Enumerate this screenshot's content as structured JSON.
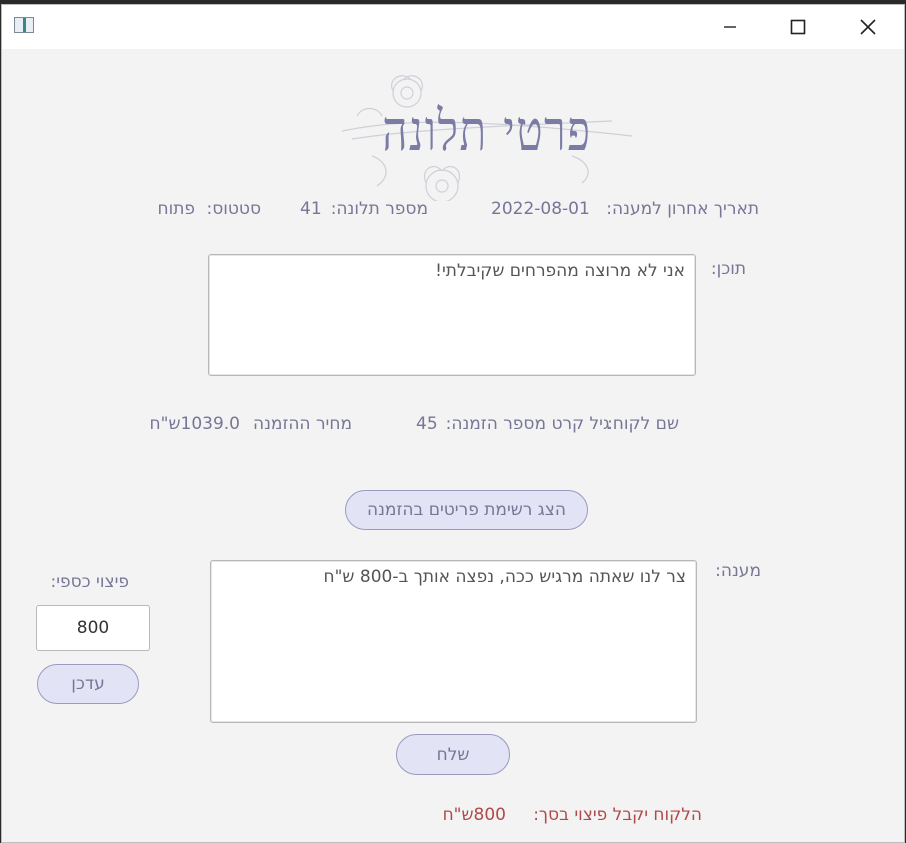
{
  "window": {
    "controls": {
      "minimize_icon": "minimize-icon",
      "maximize_icon": "maximize-icon",
      "close_icon": "close-icon"
    }
  },
  "header": {
    "title": "פרטי תלונה"
  },
  "complaint": {
    "status_label": "סטטוס:",
    "status_value": "פתוח",
    "number_label": "מספר תלונה:",
    "number_value": "41",
    "last_date_label": "תאריך אחרון למענה:",
    "last_date_value": "2022-08-01",
    "content_label": "תוכן:",
    "content_text": "אני לא מרוצה מהפרחים שקיבלתי!"
  },
  "order": {
    "customer_label": "שם לקוח:",
    "customer_value": "גיל קרט",
    "order_number_label": "מספר הזמנה:",
    "order_number_value": "45",
    "price_label": "מחיר ההזמנה",
    "price_value": "1039.0ש\"ח",
    "show_items_button": "הצג רשימת פריטים בהזמנה"
  },
  "response": {
    "label": "מענה:",
    "text": "צר לנו שאתה מרגיש ככה, נפצה אותך ב-800 ש\"ח",
    "send_button": "שלח"
  },
  "compensation": {
    "label": "פיצוי כספי:",
    "value": "800",
    "update_button": "עדכן",
    "result_label": "הלקוח יקבל פיצוי בסך:",
    "result_value": "800ש\"ח"
  },
  "colors": {
    "accent": "#767696",
    "button_bg": "#e3e3f6",
    "button_border": "#9a9ac2",
    "result_text": "#b04a4a",
    "window_bg": "#f3f3f3"
  }
}
